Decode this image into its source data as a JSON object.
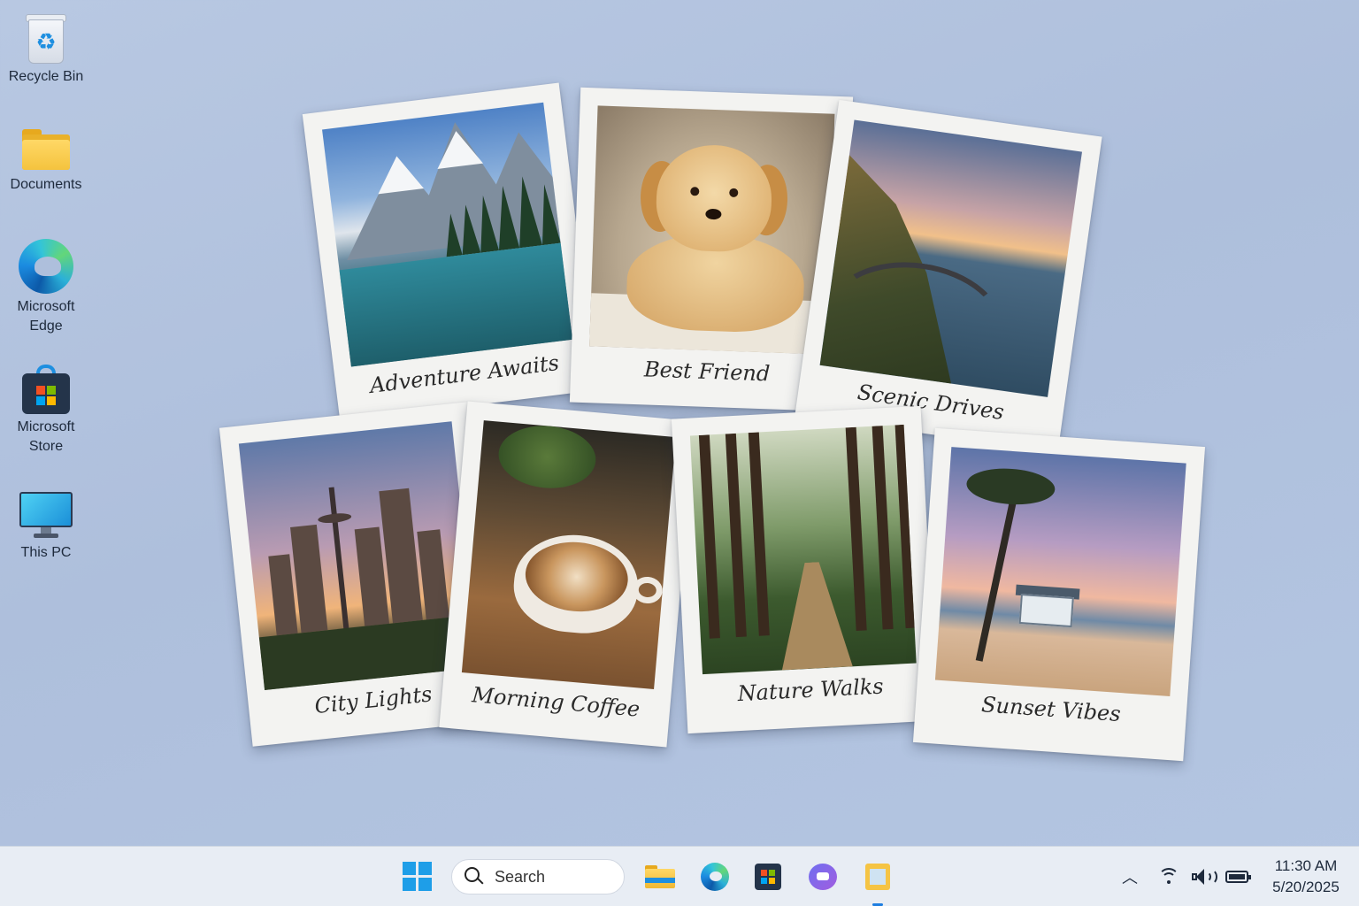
{
  "desktop": {
    "icons": [
      {
        "label": "Recycle Bin",
        "icon": "recycle-bin-icon"
      },
      {
        "label": "Documents",
        "icon": "folder-icon"
      },
      {
        "label": "Microsoft Edge",
        "icon": "edge-icon"
      },
      {
        "label": "Microsoft Store",
        "icon": "store-icon"
      },
      {
        "label": "This PC",
        "icon": "monitor-icon"
      }
    ]
  },
  "polaroids": [
    {
      "caption": "Adventure Awaits",
      "scene": "mountain-lake"
    },
    {
      "caption": "Best Friend",
      "scene": "golden-puppy"
    },
    {
      "caption": "Scenic Drives",
      "scene": "coastal-road"
    },
    {
      "caption": "City Lights",
      "scene": "city-skyline"
    },
    {
      "caption": "Morning Coffee",
      "scene": "latte-cup"
    },
    {
      "caption": "Nature Walks",
      "scene": "forest-path"
    },
    {
      "caption": "Sunset Vibes",
      "scene": "beach-palm"
    }
  ],
  "taskbar": {
    "search_placeholder": "Search",
    "pinned": [
      "file-explorer-icon",
      "edge-icon",
      "store-icon",
      "chat-icon",
      "notes-icon"
    ],
    "clock": {
      "time": "11:30 AM",
      "date": "5/20/2025"
    }
  },
  "colors": {
    "desktop_bg": "#b4c6e2",
    "taskbar_bg": "#e8edf4",
    "accent": "#1e9ee8"
  }
}
